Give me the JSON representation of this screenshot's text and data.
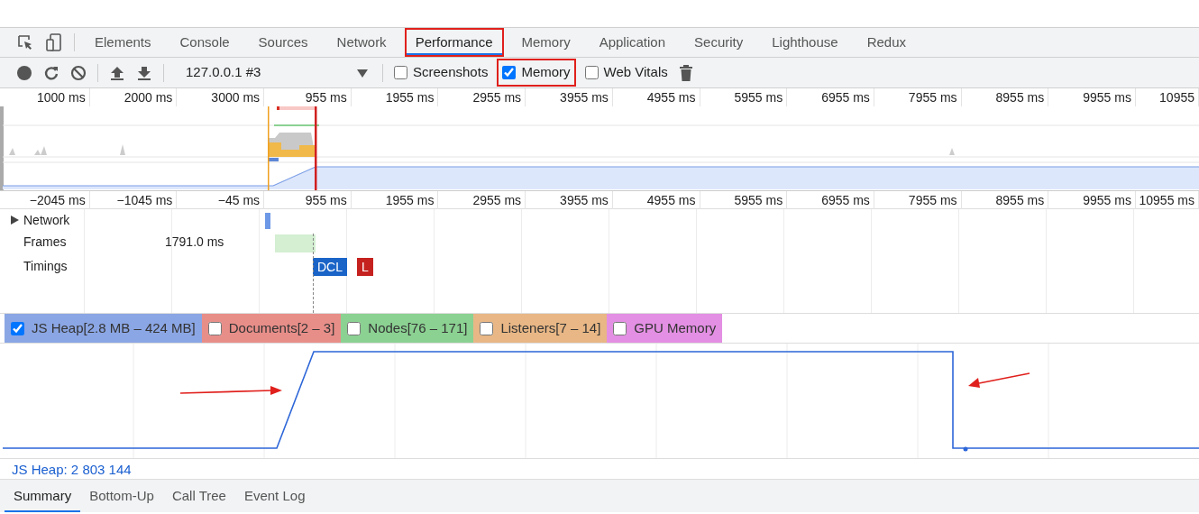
{
  "tabs": [
    {
      "label": "Elements",
      "selected": false,
      "highlighted": false
    },
    {
      "label": "Console",
      "selected": false,
      "highlighted": false
    },
    {
      "label": "Sources",
      "selected": false,
      "highlighted": false
    },
    {
      "label": "Network",
      "selected": false,
      "highlighted": false
    },
    {
      "label": "Performance",
      "selected": true,
      "highlighted": true
    },
    {
      "label": "Memory",
      "selected": false,
      "highlighted": false
    },
    {
      "label": "Application",
      "selected": false,
      "highlighted": false
    },
    {
      "label": "Security",
      "selected": false,
      "highlighted": false
    },
    {
      "label": "Lighthouse",
      "selected": false,
      "highlighted": false
    },
    {
      "label": "Redux",
      "selected": false,
      "highlighted": false
    }
  ],
  "toolbar": {
    "target": "127.0.0.1 #3",
    "options": [
      {
        "label": "Screenshots",
        "checked": false,
        "highlighted": false
      },
      {
        "label": "Memory",
        "checked": true,
        "highlighted": true
      },
      {
        "label": "Web Vitals",
        "checked": false,
        "highlighted": false
      }
    ]
  },
  "overview": {
    "ticks": [
      "1000 ms",
      "2000 ms",
      "3000 ms",
      "955 ms",
      "1955 ms",
      "2955 ms",
      "3955 ms",
      "4955 ms",
      "5955 ms",
      "6955 ms",
      "7955 ms",
      "8955 ms",
      "9955 ms",
      "10955"
    ]
  },
  "ruler": {
    "ticks": [
      "−2045 ms",
      "−1045 ms",
      "−45 ms",
      "955 ms",
      "1955 ms",
      "2955 ms",
      "3955 ms",
      "4955 ms",
      "5955 ms",
      "6955 ms",
      "7955 ms",
      "8955 ms",
      "9955 ms",
      "10955 ms"
    ]
  },
  "tracks": [
    {
      "kind": "network",
      "label": "Network"
    },
    {
      "kind": "frames",
      "label": "Frames",
      "value": "1791.0 ms"
    },
    {
      "kind": "timings",
      "label": "Timings",
      "markers": [
        {
          "label": "DCL",
          "color": "#1a64c8"
        },
        {
          "label": "L",
          "color": "#c5221f"
        }
      ]
    }
  ],
  "counters": [
    {
      "label": "JS Heap[2.8 MB – 424 MB]",
      "checked": true,
      "color": "#8ba6e4"
    },
    {
      "label": "Documents[2 – 3]",
      "checked": false,
      "color": "#e88e89"
    },
    {
      "label": "Nodes[76 – 171]",
      "checked": false,
      "color": "#8bd192"
    },
    {
      "label": "Listeners[7 – 14]",
      "checked": false,
      "color": "#e8b785"
    },
    {
      "label": "GPU Memory",
      "checked": false,
      "color": "#e38fe3"
    }
  ],
  "heap_readout": "JS Heap: 2 803 144",
  "bottom_tabs": [
    {
      "label": "Summary",
      "selected": true
    },
    {
      "label": "Bottom-Up",
      "selected": false
    },
    {
      "label": "Call Tree",
      "selected": false
    },
    {
      "label": "Event Log",
      "selected": false
    }
  ]
}
